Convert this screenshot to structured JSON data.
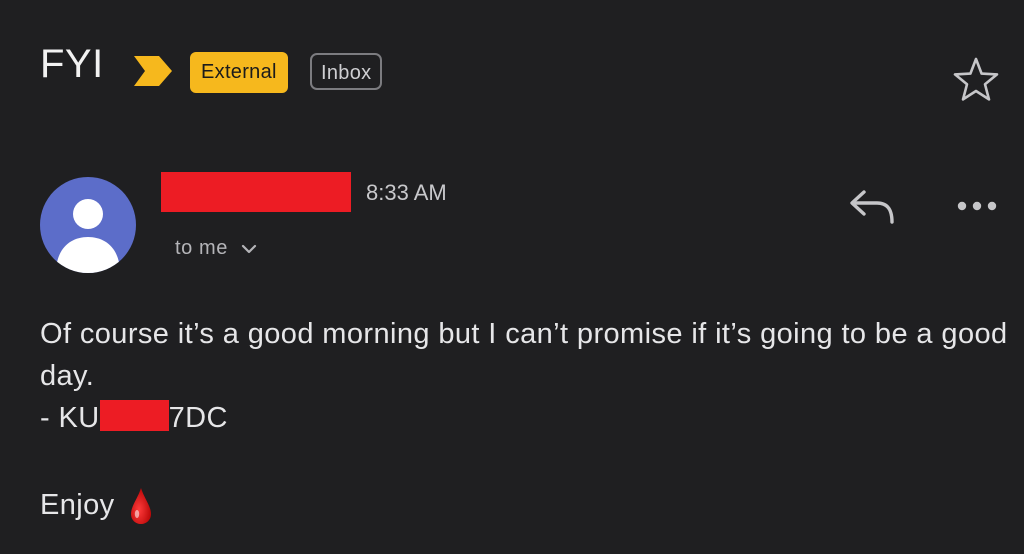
{
  "email": {
    "subject": "FYI",
    "labels": {
      "external": "External",
      "inbox": "Inbox"
    },
    "time": "8:33 AM",
    "recipients": "to me",
    "body_line": "Of course it’s a good morning but I can’t promise if it’s going to be a good day.",
    "signature_prefix": "- KU",
    "signature_suffix": "7DC",
    "closing": "Enjoy"
  },
  "icons": {
    "importance": "importance-marker-icon",
    "star": "star-icon",
    "avatar": "default-avatar-icon",
    "chevron": "chevron-down-icon",
    "reply": "reply-icon",
    "more": "more-options-icon",
    "emoji": "drop-of-blood-icon"
  },
  "colors": {
    "background": "#1f1f21",
    "external_label": "#f6b81d",
    "importance_marker": "#f6b81d",
    "avatar": "#5c6dc9",
    "redaction": "#ed1c24"
  }
}
